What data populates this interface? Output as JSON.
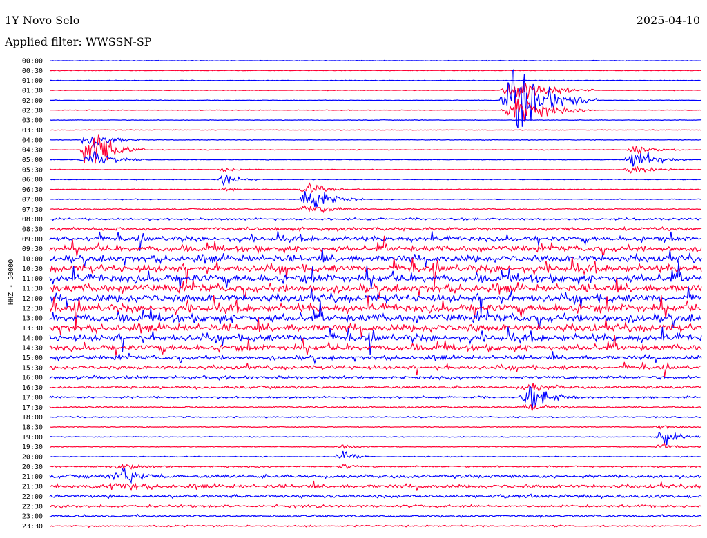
{
  "header": {
    "station": "1Y Novo Selo",
    "date": "2025-04-10",
    "filter": "Applied filter: WWSSN-SP"
  },
  "chart_data": {
    "type": "line",
    "title": "1Y Novo Selo",
    "ylabel": "HHZ - 50000",
    "row_labels": [
      "00:00",
      "00:30",
      "01:00",
      "01:30",
      "02:00",
      "02:30",
      "03:00",
      "03:30",
      "04:00",
      "04:30",
      "05:00",
      "05:30",
      "06:00",
      "06:30",
      "07:00",
      "07:30",
      "08:00",
      "08:30",
      "09:00",
      "09:30",
      "10:00",
      "10:30",
      "11:00",
      "11:30",
      "12:00",
      "12:30",
      "13:00",
      "13:30",
      "14:00",
      "14:30",
      "15:00",
      "15:30",
      "16:00",
      "16:30",
      "17:00",
      "17:30",
      "18:00",
      "18:30",
      "19:00",
      "19:30",
      "20:00",
      "20:30",
      "21:00",
      "21:30",
      "22:00",
      "22:30",
      "23:00",
      "23:30"
    ],
    "series_colors": [
      "#0000ff",
      "#ff0033"
    ],
    "row_noise_level": [
      0.6,
      0.6,
      0.6,
      0.6,
      0.6,
      0.6,
      0.6,
      0.6,
      0.6,
      0.6,
      0.6,
      0.6,
      0.7,
      0.7,
      0.8,
      1.2,
      2.0,
      3.0,
      4.5,
      5.5,
      6.5,
      7.0,
      7.5,
      7.5,
      7.5,
      7.5,
      7.5,
      7.0,
      6.5,
      5.5,
      4.0,
      3.5,
      3.0,
      2.5,
      2.0,
      1.5,
      1.2,
      1.0,
      0.8,
      0.8,
      0.8,
      1.5,
      3.0,
      3.5,
      3.0,
      2.5,
      2.0,
      1.5
    ],
    "events": [
      {
        "row": 9,
        "x": 0.065,
        "amp": 60,
        "width": 0.02
      },
      {
        "row": 4,
        "x": 0.72,
        "amp": 90,
        "width": 0.03
      },
      {
        "row": 14,
        "x": 0.4,
        "amp": 35,
        "width": 0.02
      },
      {
        "row": 10,
        "x": 0.9,
        "amp": 25,
        "width": 0.02
      },
      {
        "row": 12,
        "x": 0.27,
        "amp": 12,
        "width": 0.015
      },
      {
        "row": 34,
        "x": 0.74,
        "amp": 25,
        "width": 0.02
      },
      {
        "row": 38,
        "x": 0.94,
        "amp": 20,
        "width": 0.015
      },
      {
        "row": 40,
        "x": 0.45,
        "amp": 15,
        "width": 0.012
      },
      {
        "row": 42,
        "x": 0.11,
        "amp": 18,
        "width": 0.02
      }
    ]
  }
}
